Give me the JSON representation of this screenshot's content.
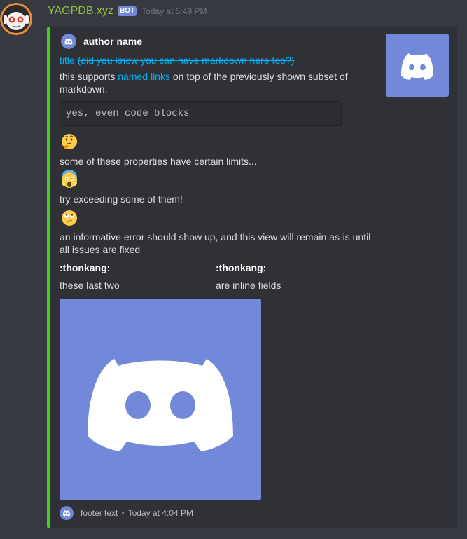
{
  "message": {
    "username": "YAGPDB.xyz",
    "bot_tag": "BOT",
    "timestamp": "Today at 5:49 PM",
    "avatar_icon": "yagpdb-robot-avatar"
  },
  "embed": {
    "accent_color": "#43d31c",
    "author": {
      "name": "author name",
      "icon": "discord-logo-icon"
    },
    "title": {
      "link_text": "title",
      "strike_text": "(did you know you can have markdown here too?)"
    },
    "description": {
      "before_link": "this supports ",
      "link_text": "named links",
      "after_link": " on top of the previously shown subset of markdown.",
      "code_block": "yes, even code blocks",
      "emoji_1": "thinking-face",
      "line_1": "some of these properties have certain limits...",
      "emoji_2": "face-screaming-in-fear",
      "line_2": "try exceeding some of them!",
      "emoji_3": "face-with-rolling-eyes",
      "line_3": "an informative error should show up, and this view will remain as-is until all issues are fixed"
    },
    "fields": [
      {
        "name": ":thonkang:",
        "value": "these last two"
      },
      {
        "name": ":thonkang:",
        "value": "are inline fields"
      }
    ],
    "thumbnail": "discord-logo",
    "image": "discord-logo",
    "footer": {
      "text": "footer text",
      "separator": "•",
      "timestamp": "Today at 4:04 PM",
      "icon": "discord-logo-icon"
    }
  },
  "colors": {
    "background": "#36393f",
    "embed_background": "#2f3136",
    "blurple": "#7289da",
    "link": "#00b0f4",
    "username": "#8fbf3f"
  }
}
